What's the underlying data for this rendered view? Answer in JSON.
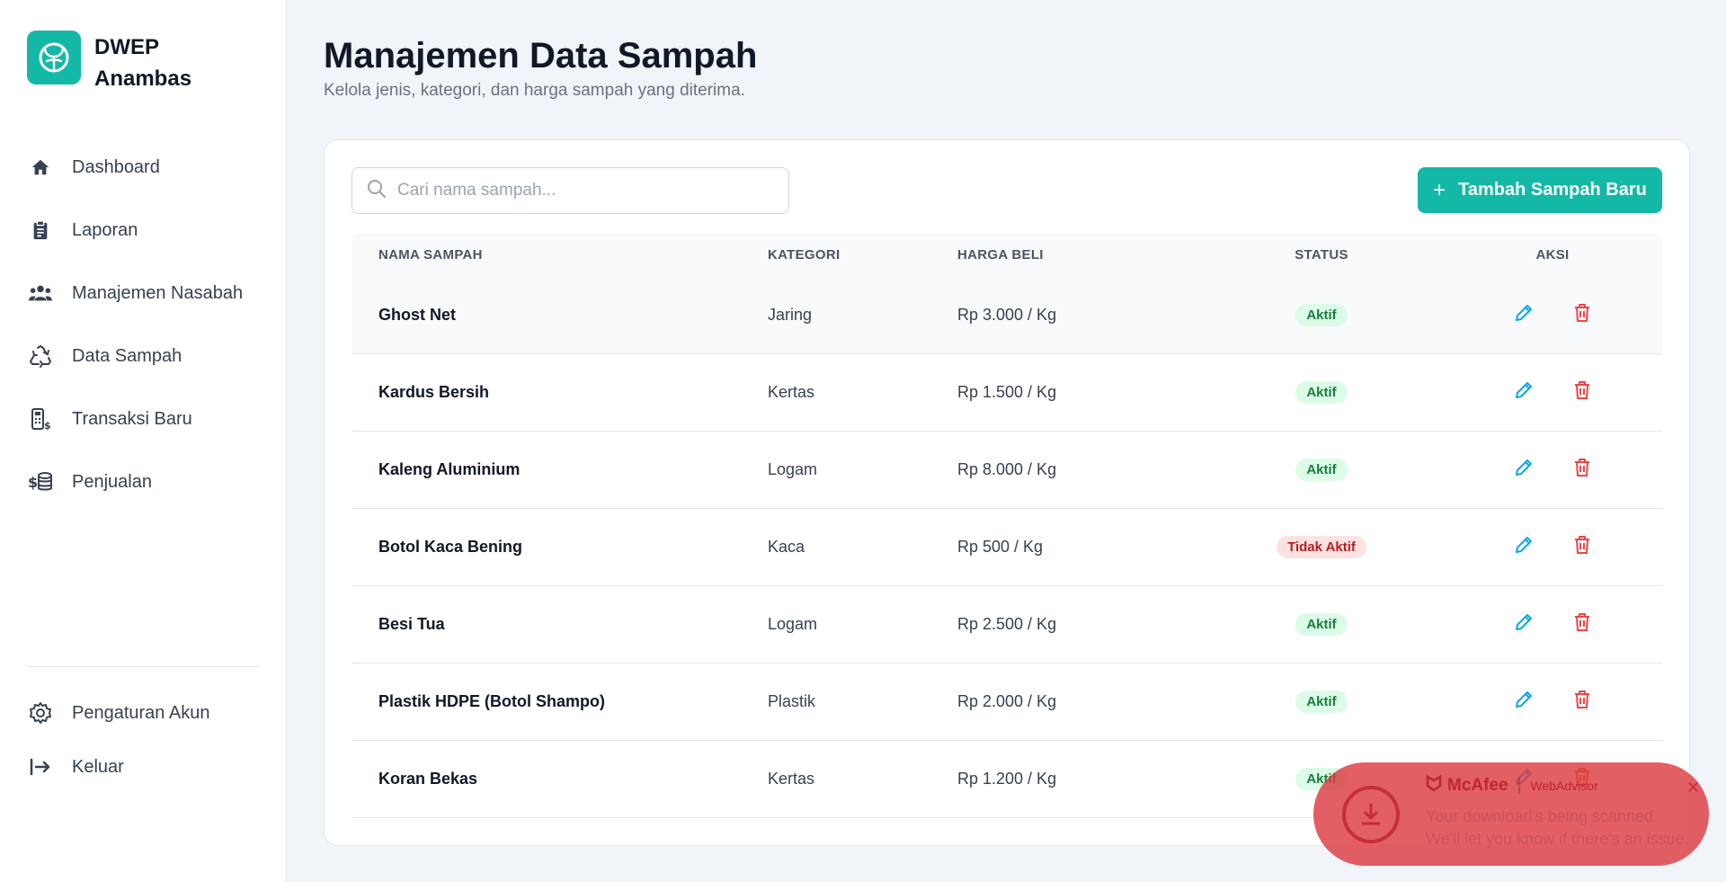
{
  "brand": {
    "name": "DWEP Anambas",
    "color": "#14b8a6"
  },
  "nav": [
    {
      "label": "Dashboard",
      "icon": "home-icon"
    },
    {
      "label": "Laporan",
      "icon": "clipboard-icon"
    },
    {
      "label": "Manajemen Nasabah",
      "icon": "users-icon"
    },
    {
      "label": "Data Sampah",
      "icon": "recycle-icon"
    },
    {
      "label": "Transaksi Baru",
      "icon": "cash-register-icon"
    },
    {
      "label": "Penjualan",
      "icon": "money-icon"
    }
  ],
  "nav_bottom": [
    {
      "label": "Pengaturan Akun",
      "icon": "gear-icon"
    },
    {
      "label": "Keluar",
      "icon": "logout-icon"
    }
  ],
  "page": {
    "title": "Manajemen Data Sampah",
    "subtitle": "Kelola jenis, kategori, dan harga sampah yang diterima."
  },
  "search": {
    "placeholder": "Cari nama sampah...",
    "value": ""
  },
  "add_button": {
    "label": "Tambah Sampah Baru"
  },
  "table": {
    "headers": [
      "NAMA SAMPAH",
      "KATEGORI",
      "HARGA BELI",
      "STATUS",
      "AKSI"
    ],
    "rows": [
      {
        "name": "Ghost Net",
        "category": "Jaring",
        "price": "Rp 3.000 / Kg",
        "status": "Aktif"
      },
      {
        "name": "Kardus Bersih",
        "category": "Kertas",
        "price": "Rp 1.500 / Kg",
        "status": "Aktif"
      },
      {
        "name": "Kaleng Aluminium",
        "category": "Logam",
        "price": "Rp 8.000 / Kg",
        "status": "Aktif"
      },
      {
        "name": "Botol Kaca Bening",
        "category": "Kaca",
        "price": "Rp 500 / Kg",
        "status": "Tidak Aktif"
      },
      {
        "name": "Besi Tua",
        "category": "Logam",
        "price": "Rp 2.500 / Kg",
        "status": "Aktif"
      },
      {
        "name": "Plastik HDPE (Botol Shampo)",
        "category": "Plastik",
        "price": "Rp 2.000 / Kg",
        "status": "Aktif"
      },
      {
        "name": "Koran Bekas",
        "category": "Kertas",
        "price": "Rp 1.200 / Kg",
        "status": "Aktif"
      }
    ]
  },
  "toast": {
    "brand": "McAfee",
    "product": "WebAdvisor",
    "message_line1": "Your download's being scanned.",
    "message_line2": "We'll let you know if there's an issue."
  },
  "colors": {
    "accent": "#14b8a6",
    "edit": "#0ea5e9",
    "delete": "#ef4444",
    "active_bg": "#dcfce7",
    "inactive_bg": "#fee2e2"
  }
}
